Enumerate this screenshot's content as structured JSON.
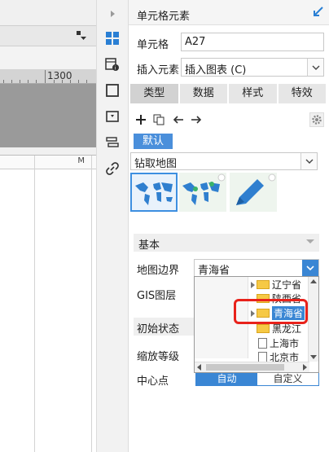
{
  "panel": {
    "title": "单元格元素",
    "cell_label": "单元格",
    "cell_value": "A27",
    "insert_label": "插入元素",
    "insert_value": "插入图表 (C)"
  },
  "tabs": [
    {
      "label": "类型"
    },
    {
      "label": "数据"
    },
    {
      "label": "样式"
    },
    {
      "label": "特效"
    }
  ],
  "default_button": "默认",
  "map_type": "钻取地图",
  "basic": {
    "section_label": "基本",
    "border_label": "地图边界",
    "border_value": "青海省",
    "gis_label": "GIS图层",
    "init_label": "初始状态",
    "zoom_label": "缩放等级",
    "center_label": "中心点",
    "center_auto": "自动",
    "center_custom": "自定义"
  },
  "tree": [
    {
      "label": "辽宁省",
      "type": "folder",
      "selected": false
    },
    {
      "label": "陕西省",
      "type": "folder",
      "selected": false
    },
    {
      "label": "青海省",
      "type": "folder",
      "selected": true
    },
    {
      "label": "黑龙江",
      "type": "folder",
      "selected": false
    },
    {
      "label": "上海市",
      "type": "doc",
      "selected": false
    },
    {
      "label": "北京市",
      "type": "doc",
      "selected": false
    }
  ],
  "sheet": {
    "ruler_label": "1300",
    "column_label": "M"
  },
  "colors": {
    "accent": "#3a86d4",
    "highlight": "#e8221b",
    "canvas": "#9a9a9a"
  }
}
